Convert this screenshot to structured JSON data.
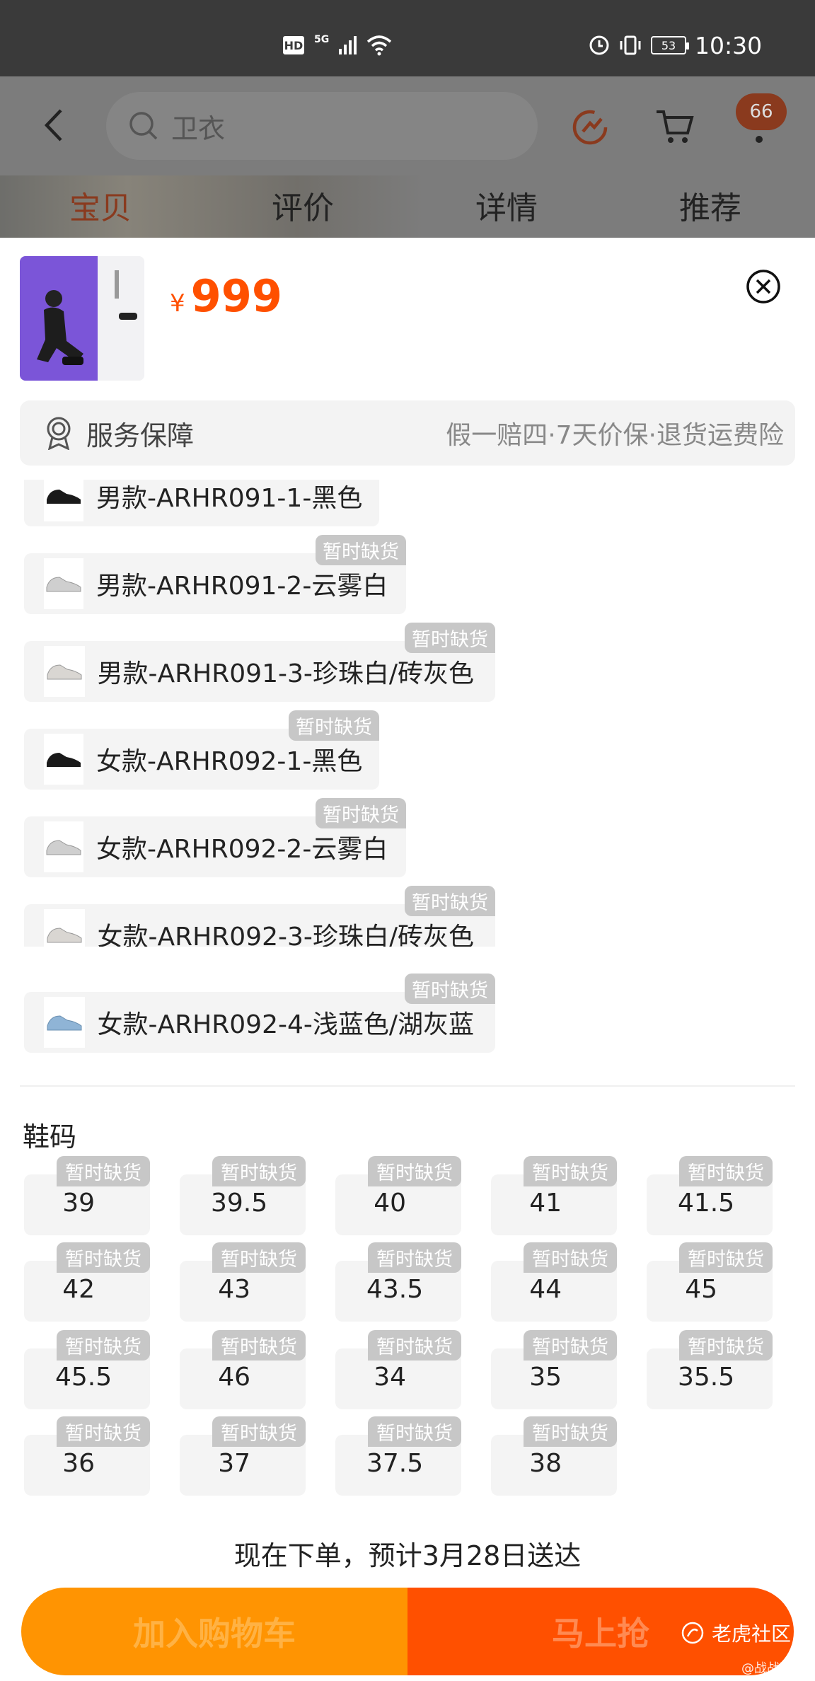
{
  "status_bar": {
    "hd": "HD",
    "network": "5G",
    "time": "10:30",
    "battery": "53"
  },
  "header": {
    "search_placeholder": "卫衣",
    "cart_badge": "66",
    "tabs": [
      "宝贝",
      "评价",
      "详情",
      "推荐"
    ],
    "active_tab": "宝贝"
  },
  "product": {
    "currency": "¥",
    "price": "999"
  },
  "service": {
    "label": "服务保障",
    "desc": "假一赔四·7天价保·退货运费险"
  },
  "variants": [
    {
      "name": "男款-ARHR091-1-黑色",
      "stock": ""
    },
    {
      "name": "男款-ARHR091-2-云雾白",
      "stock": "暂时缺货"
    },
    {
      "name": "男款-ARHR091-3-珍珠白/砖灰色",
      "stock": "暂时缺货"
    },
    {
      "name": "女款-ARHR092-1-黑色",
      "stock": "暂时缺货"
    },
    {
      "name": "女款-ARHR092-2-云雾白",
      "stock": "暂时缺货"
    },
    {
      "name": "女款-ARHR092-3-珍珠白/砖灰色",
      "stock": "暂时缺货"
    },
    {
      "name": "女款-ARHR092-4-浅蓝色/湖灰蓝",
      "stock": "暂时缺货"
    }
  ],
  "sizes": {
    "title": "鞋码",
    "stock_label": "暂时缺货",
    "values": [
      "39",
      "39.5",
      "40",
      "41",
      "41.5",
      "42",
      "43",
      "43.5",
      "44",
      "45",
      "45.5",
      "46",
      "34",
      "35",
      "35.5",
      "36",
      "37",
      "37.5",
      "38"
    ]
  },
  "delivery": "现在下单，预计3月28日送达",
  "actions": {
    "add_to_cart": "加入购物车",
    "buy_now": "马上抢"
  },
  "watermark": {
    "brand": "老虎社区",
    "user": "@战战豆"
  },
  "colors": {
    "accent": "#ff5000",
    "cart": "#ff9402",
    "oos_badge": "#c7c7c7"
  }
}
